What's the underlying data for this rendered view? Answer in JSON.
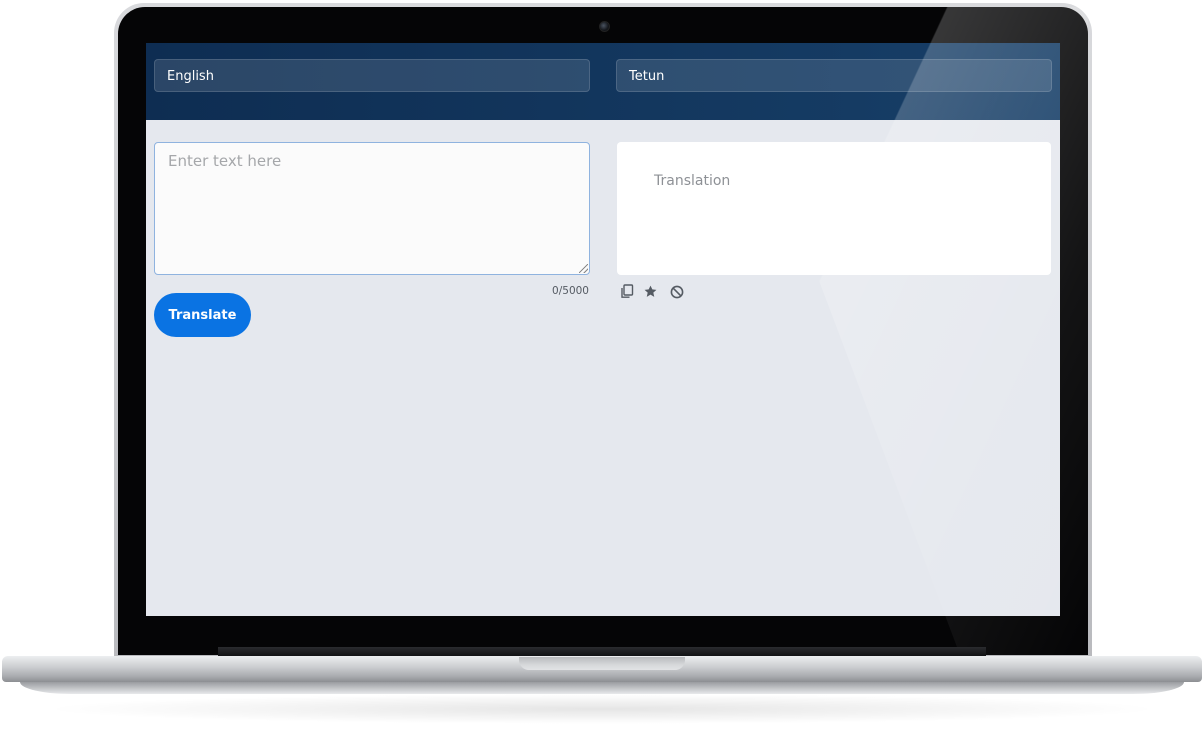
{
  "header": {
    "source_language": "English",
    "target_language": "Tetun"
  },
  "input": {
    "placeholder": "Enter text here",
    "value": "",
    "char_count": "0/5000"
  },
  "actions": {
    "translate_label": "Translate"
  },
  "output": {
    "placeholder_text": "Translation"
  },
  "output_tools": {
    "icons": [
      "copy-icon",
      "star-icon",
      "block-icon"
    ]
  },
  "colors": {
    "header_bg": "#0e2d52",
    "accent": "#0a73e3",
    "page_bg": "#e5e8ee"
  }
}
